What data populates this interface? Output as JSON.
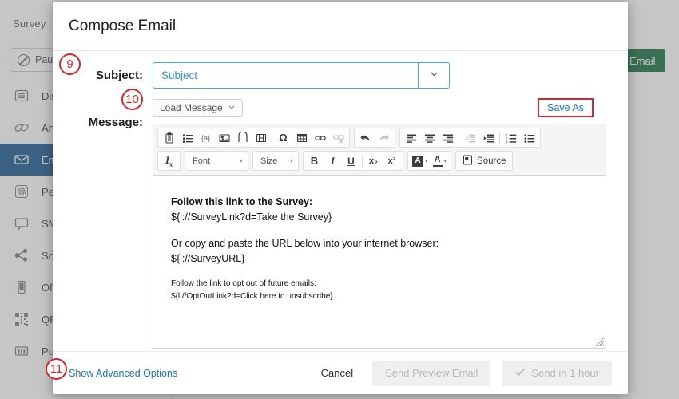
{
  "background": {
    "tab_label": "Survey",
    "pause_button": "Pause",
    "email_button": "Email",
    "email_button_color": "#0d6b3c",
    "sidebar": {
      "active_color": "#10538c",
      "items": [
        {
          "label": "Distributions",
          "icon": "list-icon",
          "active": false
        },
        {
          "label": "Anonymous Link",
          "icon": "link-chain-icon",
          "active": false
        },
        {
          "label": "Emails",
          "icon": "envelope-icon",
          "active": true
        },
        {
          "label": "Personal Links",
          "icon": "fingerprint-icon",
          "active": false
        },
        {
          "label": "SMS",
          "icon": "chat-bubble-icon",
          "active": false
        },
        {
          "label": "Social Media",
          "icon": "share-nodes-icon",
          "active": false
        },
        {
          "label": "Offline App",
          "icon": "mobile-phone-icon",
          "active": false
        },
        {
          "label": "QR Code",
          "icon": "qr-code-icon",
          "active": false
        },
        {
          "label": "Purchase Responses",
          "icon": "columns-icon",
          "active": false
        }
      ]
    }
  },
  "modal": {
    "title": "Compose Email",
    "subject": {
      "label": "Subject:",
      "value": "",
      "placeholder": "Subject",
      "dropdown_icon": "chevron-down-icon",
      "border_color": "#4aa3e8",
      "text_color": "#3b8fd4"
    },
    "message": {
      "label": "Message:",
      "load_message_button": "Load Message",
      "load_message_caret": "chevron-down-icon",
      "save_as_link": "Save As",
      "save_as_highlight_color": "#d9262c"
    },
    "toolbar": {
      "row1": [
        {
          "name": "paste-icon",
          "group": 1
        },
        {
          "name": "bulleted-list-icon",
          "group": 1
        },
        {
          "name": "piped-text-icon",
          "group": 1,
          "label": "{a}"
        },
        {
          "name": "insert-image-icon",
          "group": 1
        },
        {
          "name": "page-break-icon",
          "group": 1
        },
        {
          "name": "insert-media-icon",
          "group": 1
        },
        {
          "name": "special-character-icon",
          "group": 1,
          "label": "Ω"
        },
        {
          "name": "insert-table-icon",
          "group": 1
        },
        {
          "name": "insert-link-icon",
          "group": 1
        },
        {
          "name": "unlink-icon",
          "group": 1,
          "disabled": true
        },
        {
          "name": "undo-icon",
          "group": 2
        },
        {
          "name": "redo-icon",
          "group": 2,
          "disabled": true
        },
        {
          "name": "align-left-icon",
          "group": 3
        },
        {
          "name": "align-center-icon",
          "group": 3
        },
        {
          "name": "align-right-icon",
          "group": 3
        },
        {
          "name": "outdent-icon",
          "group": 3,
          "disabled": true
        },
        {
          "name": "indent-icon",
          "group": 3
        },
        {
          "name": "numbered-list-icon",
          "group": 3
        },
        {
          "name": "bullet-list-icon",
          "group": 3
        }
      ],
      "row2": {
        "remove_format_icon": "remove-format-icon",
        "font_select": "Font",
        "size_select": "Size",
        "bold": "B",
        "italic": "I",
        "underline": "U",
        "subscript": "x₂",
        "superscript": "x²",
        "background_color_icon": "background-color-icon",
        "text_color_icon": "text-color-icon",
        "source_button": "Source"
      }
    },
    "body": {
      "line1": "Follow this link to the Survey:",
      "line2": "${l://SurveyLink?d=Take the Survey}",
      "line3": "Or copy and paste the URL below into your internet browser:",
      "line4": "${l://SurveyURL}",
      "line5": "Follow the link to opt out of future emails:",
      "line6": "${l://OptOutLink?d=Click here to unsubscribe}"
    },
    "footer": {
      "advanced_options_link": "Show Advanced Options",
      "cancel_button": "Cancel",
      "send_preview_button": "Send Preview Email",
      "send_schedule_button": "Send in 1 hour",
      "send_schedule_icon": "check-icon"
    }
  },
  "annotations": [
    {
      "id": "9",
      "number": "9",
      "target": "subject-field"
    },
    {
      "id": "10",
      "number": "10",
      "target": "load-message-button"
    },
    {
      "id": "11",
      "number": "11",
      "target": "show-advanced-options-link"
    }
  ]
}
